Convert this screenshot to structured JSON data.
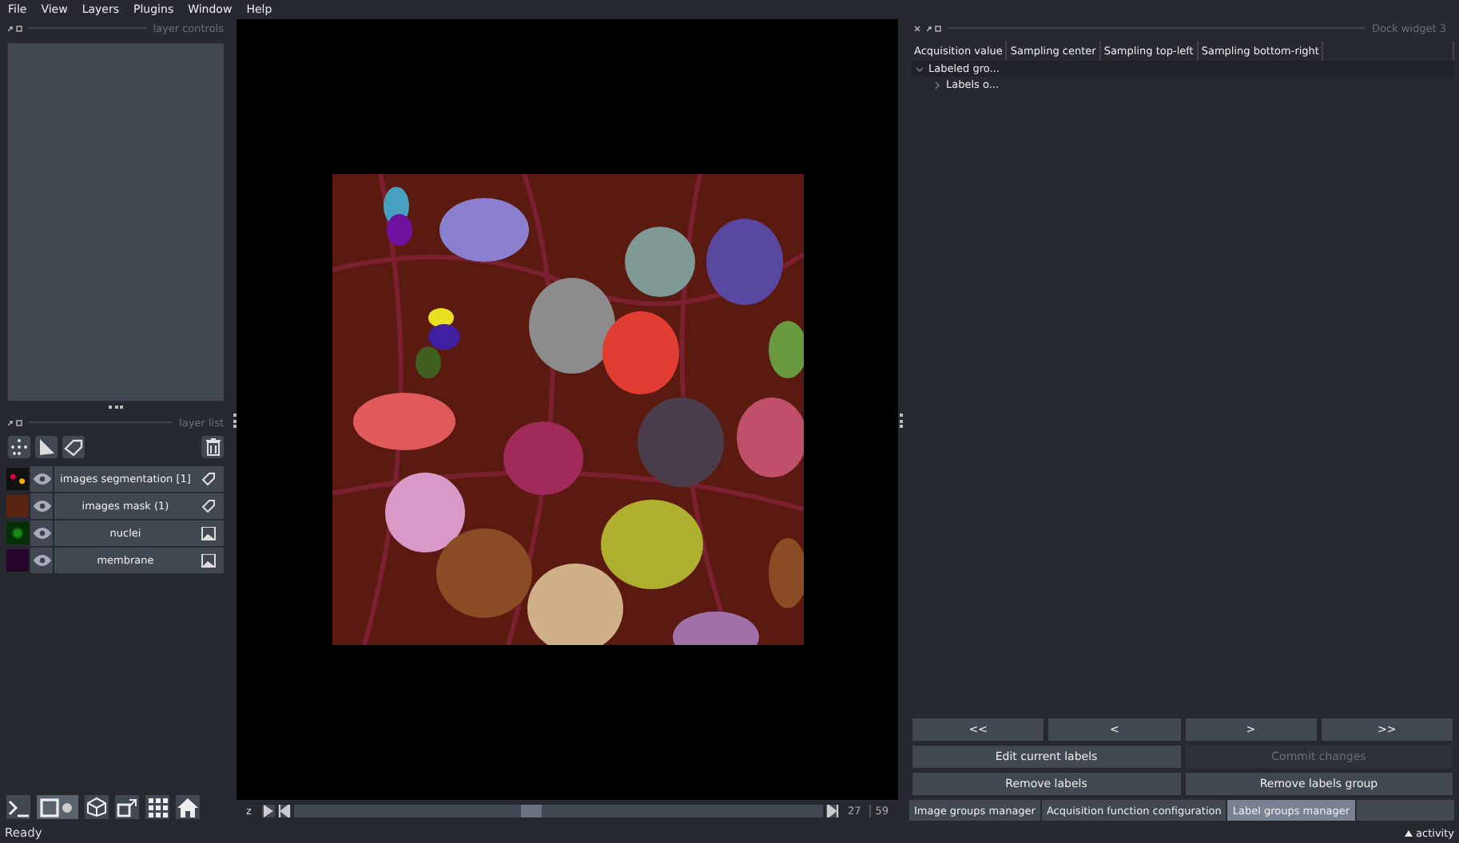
{
  "menu": [
    "File",
    "View",
    "Layers",
    "Plugins",
    "Window",
    "Help"
  ],
  "layer_controls": {
    "title": "layer controls"
  },
  "layer_list": {
    "title": "layer list",
    "layers": [
      {
        "name": "images segmentation [1]",
        "kind": "labels",
        "visible": true,
        "selected": false
      },
      {
        "name": "images mask (1)",
        "kind": "labels",
        "visible": true,
        "selected": false
      },
      {
        "name": "nuclei",
        "kind": "image",
        "visible": true,
        "selected": false
      },
      {
        "name": "membrane",
        "kind": "image",
        "visible": true,
        "selected": false
      }
    ]
  },
  "viewer": {
    "axis_label": "z",
    "slider": {
      "level": 0.46
    },
    "current": "27",
    "total": "59"
  },
  "dock": {
    "title": "Dock widget 3",
    "columns": [
      "Acquisition value",
      "Sampling center",
      "Sampling top-left",
      "Sampling bottom-right"
    ],
    "tree": [
      {
        "label": "Labeled gro...",
        "expanded": true,
        "children": [
          {
            "label": "Labels o...",
            "expanded": false
          }
        ]
      }
    ],
    "nav_buttons": [
      "<<",
      "<",
      ">",
      ">>"
    ],
    "action_buttons": [
      {
        "label": "Edit current labels",
        "disabled": false
      },
      {
        "label": "Commit changes",
        "disabled": true
      },
      {
        "label": "Remove labels",
        "disabled": false
      },
      {
        "label": "Remove labels group",
        "disabled": false
      }
    ],
    "tabs": [
      {
        "label": "Image groups manager",
        "selected": false
      },
      {
        "label": "Acquisition function configuration",
        "selected": false
      },
      {
        "label": "Label groups manager",
        "selected": true
      }
    ]
  },
  "status_bar": {
    "message": "Ready",
    "activity": "activity"
  }
}
